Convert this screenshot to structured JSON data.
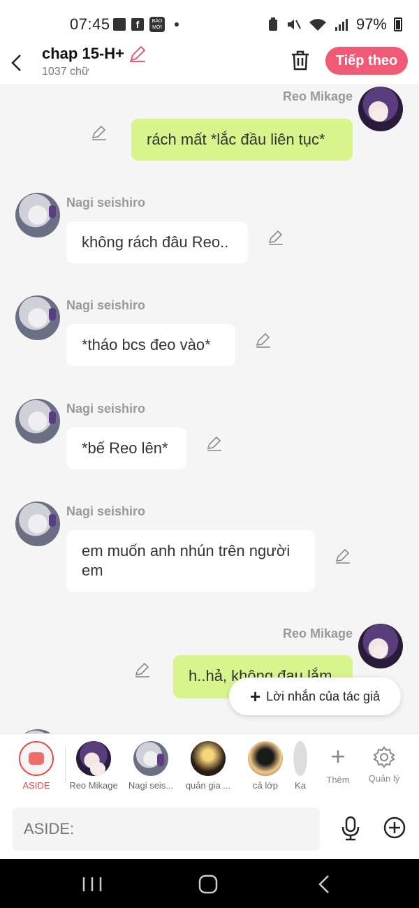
{
  "status": {
    "time": "07:45",
    "battery": "97%",
    "fb_label": "f",
    "bao_label": "BÁO MỚI"
  },
  "header": {
    "title": "chap 15-H+",
    "word_count": "1037 chữ",
    "next_label": "Tiếp theo"
  },
  "messages": [
    {
      "side": "right",
      "sender": "Reo Mikage",
      "text": "rách mất *lắc đầu liên tục*"
    },
    {
      "side": "left",
      "sender": "Nagi seishiro",
      "text": "không rách đâu Reo.."
    },
    {
      "side": "left",
      "sender": "Nagi seishiro",
      "text": "*tháo bcs đeo vào*"
    },
    {
      "side": "left",
      "sender": "Nagi seishiro",
      "text": "*bế Reo lên*"
    },
    {
      "side": "left",
      "sender": "Nagi seishiro",
      "text": "em muốn anh nhún trên người em"
    },
    {
      "side": "right",
      "sender": "Reo Mikage",
      "text": "h..hả, không đau lắm..."
    }
  ],
  "author_note": {
    "label": "Lời nhắn của tác giả"
  },
  "characters": [
    {
      "label": "ASIDE",
      "selected": true
    },
    {
      "label": "Reo Mikage"
    },
    {
      "label": "Nagi seis..."
    },
    {
      "label": "quản gia ..."
    },
    {
      "label": "cả lớp"
    },
    {
      "label": "Ka"
    }
  ],
  "actions": {
    "add_label": "Thêm",
    "manage_label": "Quản lý"
  },
  "input": {
    "placeholder": "ASIDE:"
  },
  "colors": {
    "accent": "#f05a74",
    "right_bubble": "#d7f58c",
    "left_bubble": "#ffffff"
  }
}
